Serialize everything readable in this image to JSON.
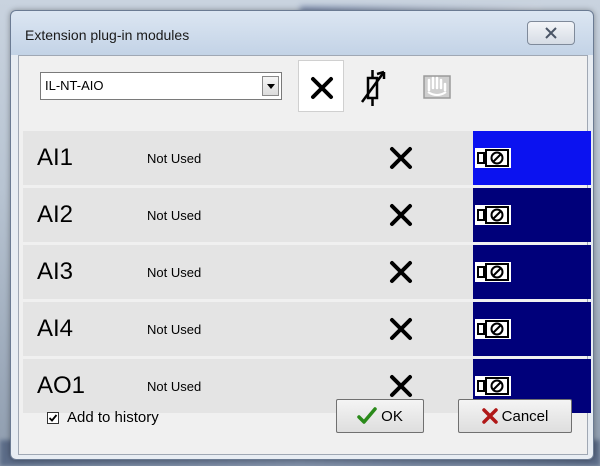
{
  "window": {
    "title": "Extension plug-in modules"
  },
  "toolbar": {
    "module_select": {
      "value": "IL-NT-AIO"
    },
    "icons": [
      "delete-icon",
      "sensor-icon",
      "hand-icon"
    ]
  },
  "rows": [
    {
      "name": "AI1",
      "status": "Not Used",
      "selected": true
    },
    {
      "name": "AI2",
      "status": "Not Used",
      "selected": false
    },
    {
      "name": "AI3",
      "status": "Not Used",
      "selected": false
    },
    {
      "name": "AI4",
      "status": "Not Used",
      "selected": false
    },
    {
      "name": "AO1",
      "status": "Not Used",
      "selected": false
    }
  ],
  "footer": {
    "history": {
      "label": "Add to history",
      "checked": true
    },
    "ok_label": "OK",
    "cancel_label": "Cancel"
  },
  "colors": {
    "selected_cell": "#0b12f0",
    "cell": "#00007a",
    "ok_check": "#2a8a1a",
    "cancel_x": "#b01818"
  }
}
